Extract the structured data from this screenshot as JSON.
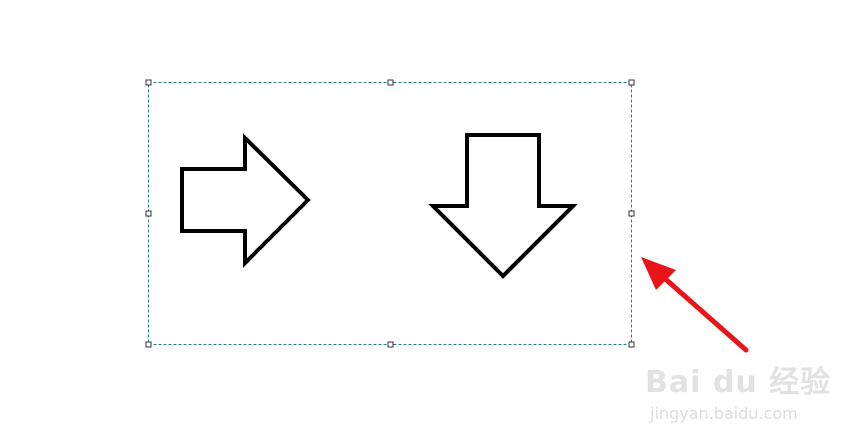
{
  "canvas": {
    "background": "#ffffff"
  },
  "selection": {
    "border_color": "#2b7a8a",
    "handle_count": 8
  },
  "shapes": [
    {
      "name": "right-arrow-shape",
      "kind": "block-arrow",
      "direction": "right",
      "stroke": "#000000",
      "fill": "#ffffff"
    },
    {
      "name": "down-arrow-shape",
      "kind": "block-arrow",
      "direction": "down",
      "stroke": "#000000",
      "fill": "#ffffff"
    }
  ],
  "annotation": {
    "name": "red-pointer-arrow-icon",
    "color": "#e8141a",
    "points_to": "selection-box-right-edge"
  },
  "watermark": {
    "brand": "Bai du 经验",
    "url": "jingyan.baidu.com",
    "color": "#e0e0e0"
  }
}
